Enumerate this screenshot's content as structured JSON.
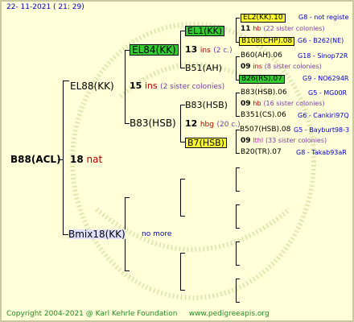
{
  "header": {
    "date": "22- 11-2021 ( 21: 29)"
  },
  "footer": {
    "copyright": "Copyright 2004-2021 @ Karl Kehrle Foundation",
    "url": "www.pedigreeapis.org"
  },
  "root": {
    "name": "B88(ACL)",
    "count": "18",
    "race": "nat"
  },
  "gen1": {
    "top": {
      "name": "EL88(KK)",
      "count": "15",
      "race": "ins",
      "colonies": "(2 sister colonies)"
    },
    "bottom": {
      "name": "Bmix18(KK)",
      "note": "no more"
    }
  },
  "gen2": {
    "a": {
      "name": "EL84(KK)",
      "count": "13",
      "race": "ins",
      "colonies": "(2 c.)"
    },
    "b": {
      "name": "B83(HSB)",
      "count": "12",
      "race": "hbg",
      "colonies": "(20 c.)"
    }
  },
  "gen3": {
    "a": {
      "name": "EL1(KK)"
    },
    "b": {
      "name": "B51(AH)"
    },
    "c": {
      "name": "B83(HSB)"
    },
    "d": {
      "name": "B7(HSB)"
    }
  },
  "gen4": [
    {
      "name": "EL2(KK).10",
      "info": "G8 - not registe"
    },
    {
      "count": "11",
      "race": "hb",
      "colonies": "(22 sister colonies)"
    },
    {
      "name": "B108(CHP).08",
      "info": "G6 - B262(NE)"
    },
    {
      "name": "B60(AH).06",
      "info": "G18 - Sinop72R"
    },
    {
      "count": "09",
      "race": "ins",
      "colonies": "(8 sister colonies)"
    },
    {
      "name": "B26(RS).07",
      "info": "G9 - NO6294R"
    },
    {
      "name": "B83(HSB).06",
      "info": "G5 - MG00R"
    },
    {
      "count": "09",
      "race": "hb",
      "colonies": "(16 sister colonies)"
    },
    {
      "name": "B351(CS).06",
      "info": "G6 - Cankiri97Q"
    },
    {
      "name": "B507(HSB).08",
      "info": "G5 - Bayburt98-3"
    },
    {
      "count": "09",
      "race": "lthl",
      "colonies": "(33 sister colonies)"
    },
    {
      "name": "B20(TR).07",
      "info": "G8 - Takab93aR"
    }
  ]
}
